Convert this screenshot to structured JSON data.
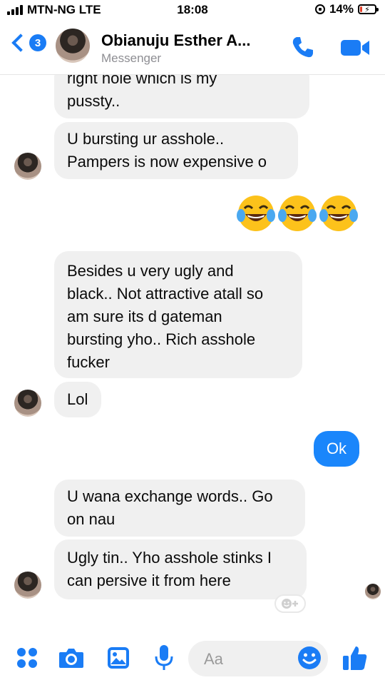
{
  "status_bar": {
    "carrier": "MTN-NG LTE",
    "time": "18:08",
    "battery": "14%",
    "battery_level": 0.14
  },
  "header": {
    "back_count": "3",
    "contact_name": "Obianuju Esther A...",
    "subtitle": "Messenger"
  },
  "messages": {
    "m1": [
      "right hole which is my",
      "pussty.."
    ],
    "m2": [
      "U bursting ur asshole..",
      "Pampers is now expensive o"
    ],
    "m3": [
      "Besides u very ugly and",
      "black.. Not attractive atall so",
      "am sure its d gateman",
      "bursting yho.. Rich asshole",
      "fucker"
    ],
    "m4": [
      "Lol"
    ],
    "out1": "Ok",
    "m5": [
      "U wana exchange words.. Go",
      "on nau"
    ],
    "m6": [
      "Ugly tin.. Yho asshole stinks I",
      "can persive it from here"
    ]
  },
  "emoji_reply": "😂😂😂",
  "composer": {
    "placeholder": "Aa"
  },
  "colors": {
    "accent": "#1a7cf5",
    "outgoing_bubble": "#1a86fb",
    "incoming_bubble": "#f0f0f0"
  },
  "icons": [
    "menu-dots-icon",
    "camera-icon",
    "image-icon",
    "microphone-icon",
    "emoji-icon",
    "like-icon",
    "phone-icon",
    "video-icon",
    "add-reaction-icon"
  ]
}
